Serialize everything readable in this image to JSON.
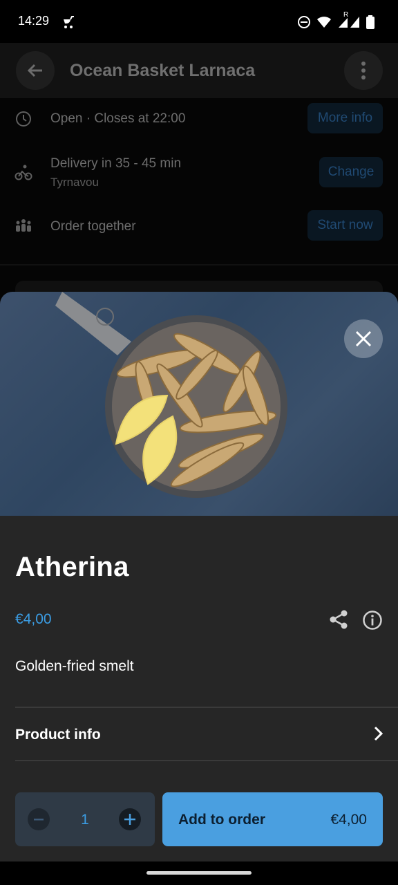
{
  "status_bar": {
    "time": "14:29",
    "roaming_label": "R"
  },
  "background_page": {
    "title": "Ocean Basket Larnaca",
    "rows": [
      {
        "text": "Open · Closes at 22:00",
        "sub": "",
        "button": "More info",
        "icon": "clock-icon"
      },
      {
        "text": "Delivery in 35 - 45 min",
        "sub": "Tyrnavou",
        "button": "Change",
        "icon": "bike-icon"
      },
      {
        "text": "Order together",
        "sub": "",
        "button": "Start now",
        "icon": "group-icon"
      }
    ]
  },
  "sheet": {
    "image_alt": "Pan of golden-fried smelt with lemon wedges",
    "product": {
      "name": "Atherina",
      "price": "€4,00",
      "description": "Golden-fried smelt"
    },
    "product_info_label": "Product info",
    "quantity": "1",
    "add_button": {
      "label": "Add to order",
      "price": "€4,00"
    }
  },
  "colors": {
    "accent": "#3b9de4",
    "button": "#4a9fe0",
    "sheet_bg": "#262626"
  }
}
